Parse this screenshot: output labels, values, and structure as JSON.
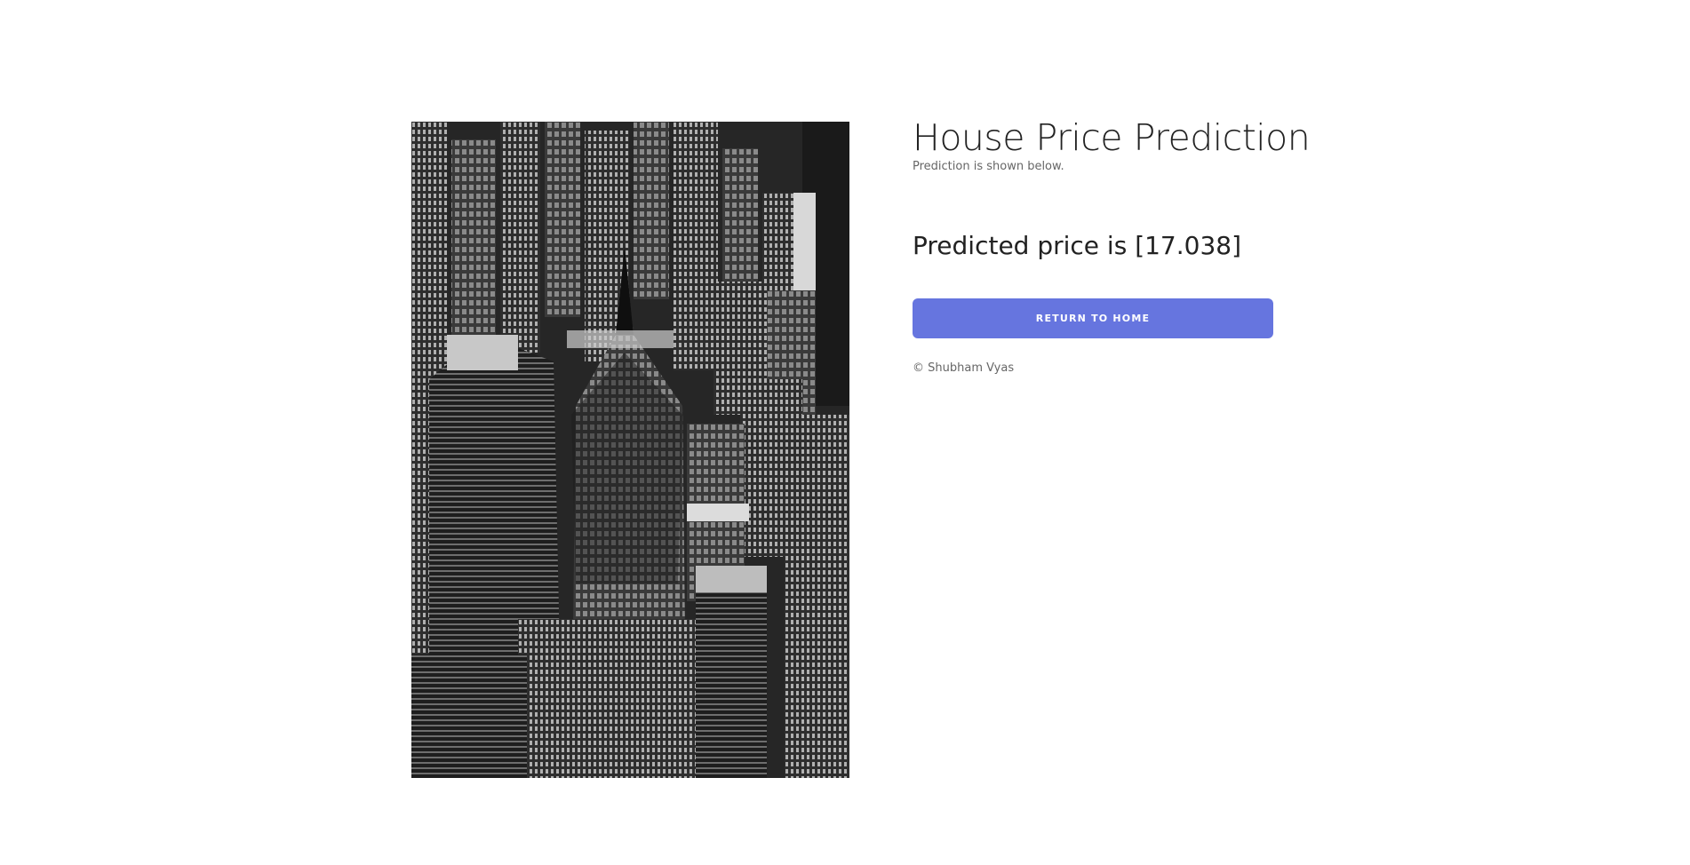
{
  "photo": {
    "alt": "Black and white aerial city skyline"
  },
  "header": {
    "title": "House Price Prediction",
    "subtitle": "Prediction is shown below."
  },
  "result": {
    "text": "Predicted price is [17.038]"
  },
  "actions": {
    "return_label": "RETURN TO HOME"
  },
  "footer": {
    "copyright": "© Shubham Vyas"
  },
  "colors": {
    "accent": "#6675df",
    "text": "#222222",
    "muted": "#666666"
  }
}
